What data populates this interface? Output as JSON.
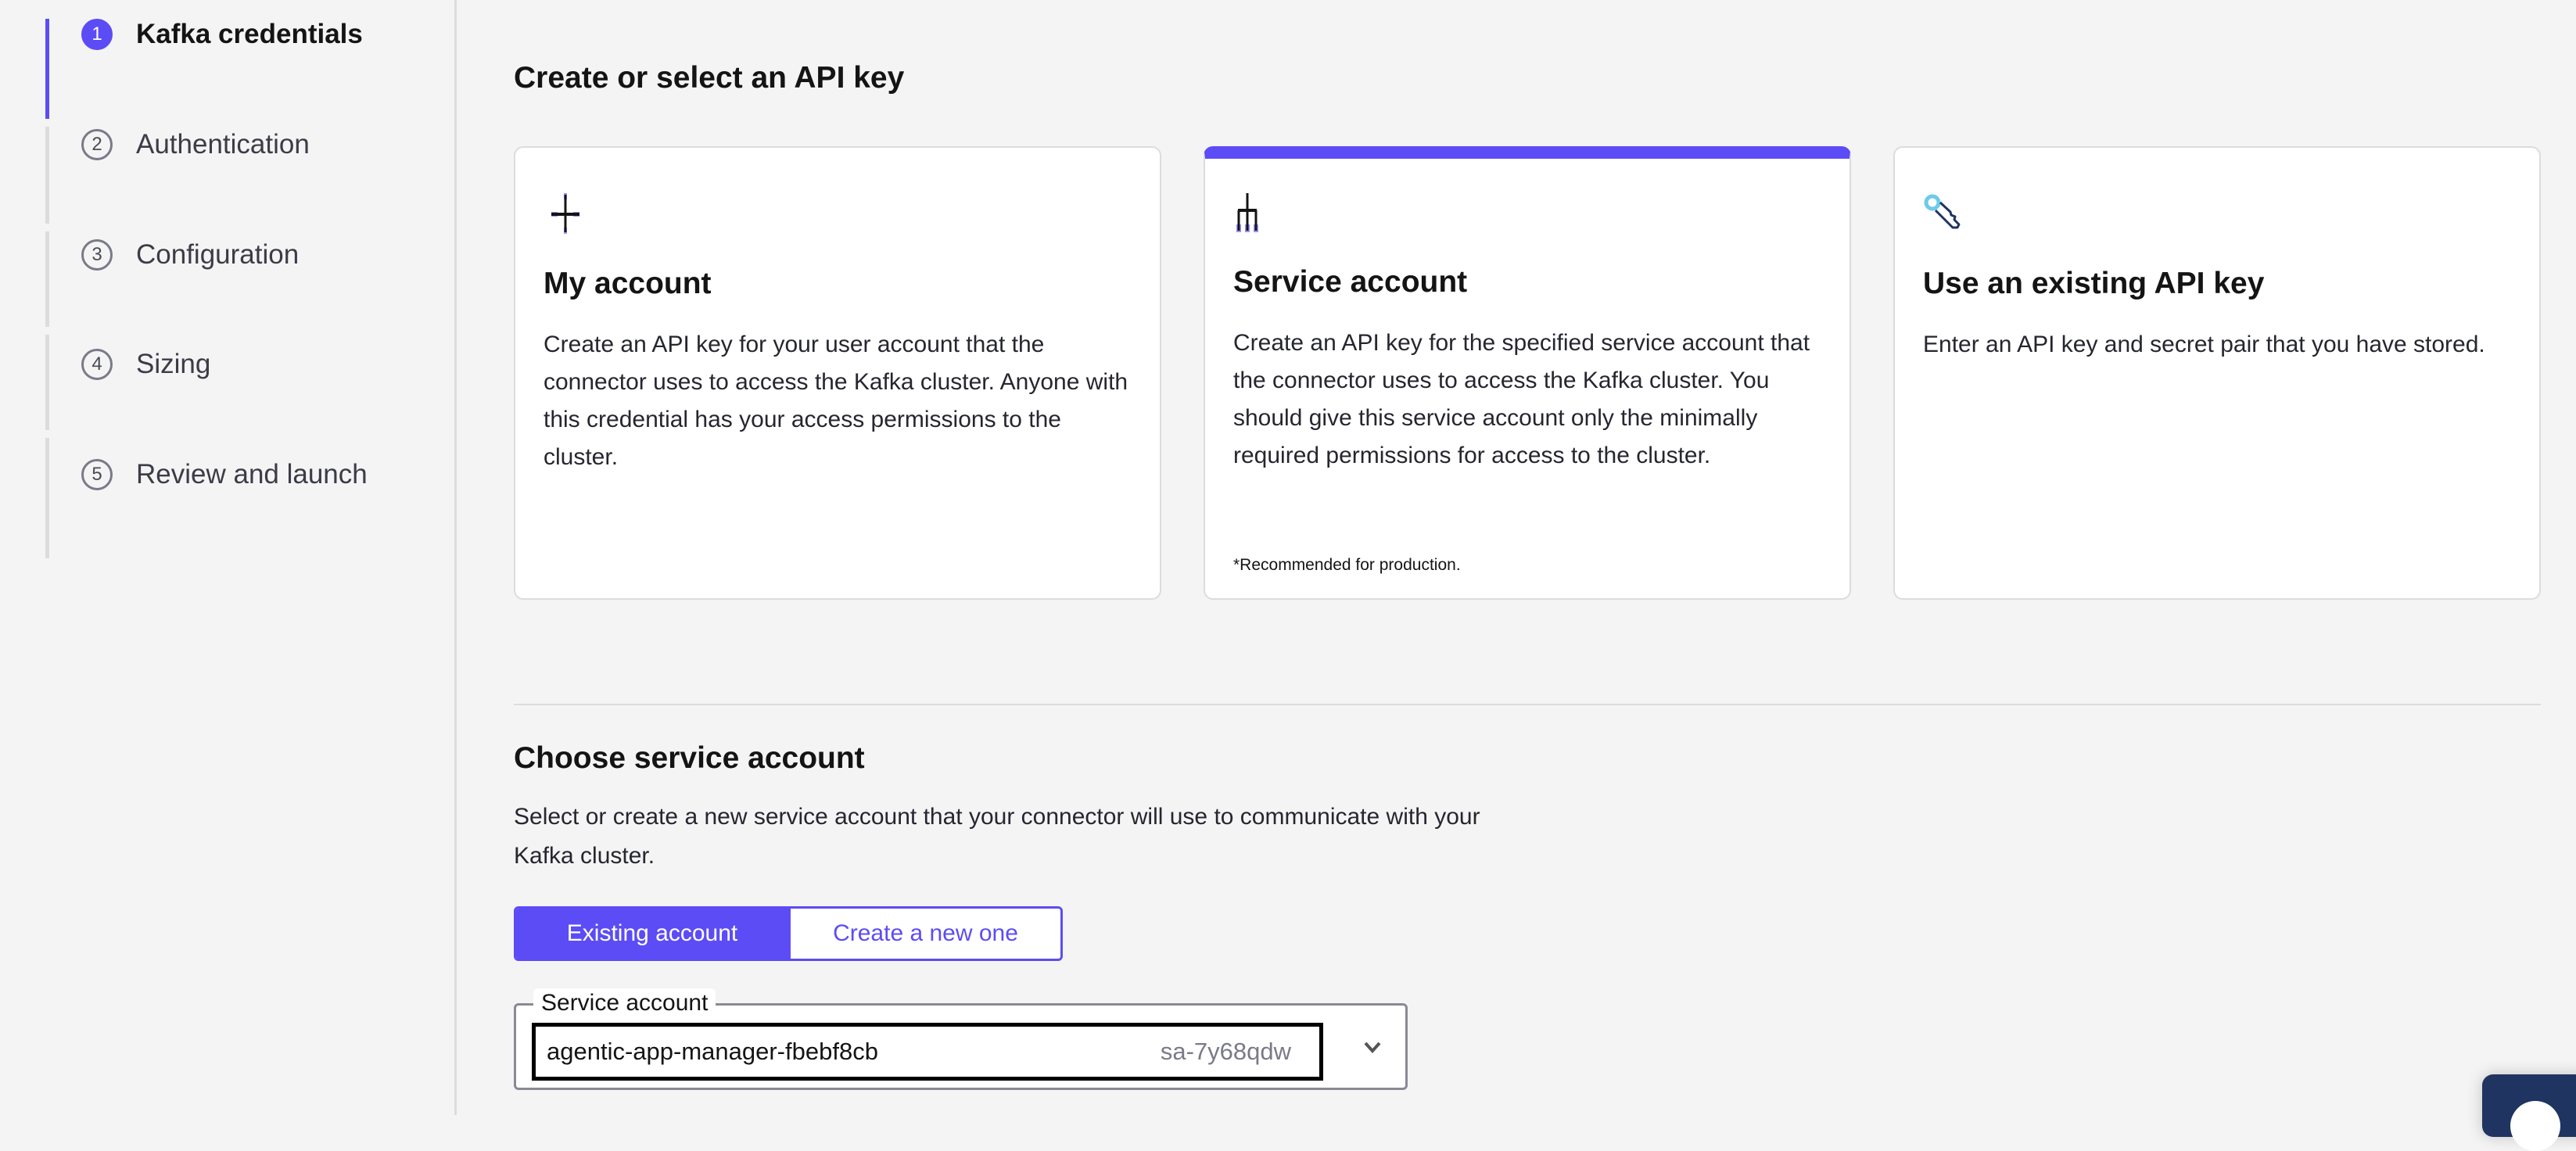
{
  "sidebar": {
    "steps": [
      {
        "number": "1",
        "label": "Kafka credentials",
        "active": true
      },
      {
        "number": "2",
        "label": "Authentication"
      },
      {
        "number": "3",
        "label": "Configuration"
      },
      {
        "number": "4",
        "label": "Sizing"
      },
      {
        "number": "5",
        "label": "Review and launch"
      }
    ]
  },
  "main": {
    "heading": "Create or select an API key",
    "cards": [
      {
        "title": "My account",
        "icon": "user-plus-icon",
        "description": "Create an API key for your user account that the connector uses to access the Kafka cluster. Anyone with this credential has your access permissions to the cluster."
      },
      {
        "title": "Service account",
        "icon": "service-account-icon",
        "selected": true,
        "description": "Create an API key for the specified service account that the connector uses to access the Kafka cluster. You should give this service account only the minimally required permissions for access to the cluster.",
        "note": "*Recommended for production."
      },
      {
        "title": "Use an existing API key",
        "icon": "key-icon",
        "description": "Enter an API key and secret pair that you have stored."
      }
    ],
    "choose": {
      "heading": "Choose service account",
      "description": "Select or create a new service account that your connector will use to communicate with your Kafka cluster.",
      "toggle": {
        "existing": "Existing account",
        "create": "Create a new one",
        "selected": "existing"
      },
      "select": {
        "label": "Service account",
        "value": "agentic-app-manager-fbebf8cb",
        "id": "sa-7y68qdw"
      }
    }
  },
  "colors": {
    "accent": "#5c4cf5",
    "fab": "#1f3461"
  }
}
